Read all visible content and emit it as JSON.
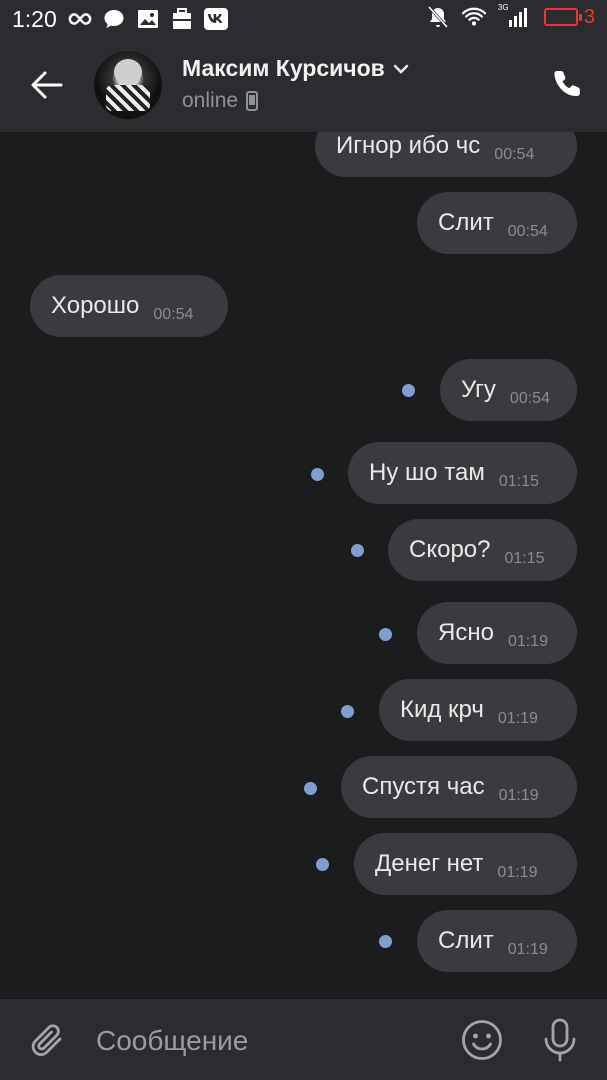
{
  "status_bar": {
    "time": "1:20",
    "battery_level": "3",
    "network_label": "3G",
    "left_icons": [
      "infinity-icon",
      "chat-bubble-icon",
      "image-icon",
      "briefcase-icon",
      "vk-icon"
    ],
    "right_icons": [
      "mute-icon",
      "wifi-icon",
      "signal-icon",
      "battery-icon"
    ]
  },
  "header": {
    "contact_name": "Максим Курсичов",
    "status": "online"
  },
  "messages": [
    {
      "text": "Игнор ибо чс",
      "time": "00:54",
      "side": "out",
      "unread": false
    },
    {
      "text": "Слит",
      "time": "00:54",
      "side": "out",
      "unread": false
    },
    {
      "text": "Хорошо",
      "time": "00:54",
      "side": "in",
      "unread": false
    },
    {
      "text": "Угу",
      "time": "00:54",
      "side": "out",
      "unread": true
    },
    {
      "text": "Ну шо там",
      "time": "01:15",
      "side": "out",
      "unread": true
    },
    {
      "text": "Скоро?",
      "time": "01:15",
      "side": "out",
      "unread": true
    },
    {
      "text": "Ясно",
      "time": "01:19",
      "side": "out",
      "unread": true
    },
    {
      "text": "Кид крч",
      "time": "01:19",
      "side": "out",
      "unread": true
    },
    {
      "text": "Спустя час",
      "time": "01:19",
      "side": "out",
      "unread": true
    },
    {
      "text": "Денег нет",
      "time": "01:19",
      "side": "out",
      "unread": true
    },
    {
      "text": "Слит",
      "time": "01:19",
      "side": "out",
      "unread": true
    }
  ],
  "composer": {
    "placeholder": "Сообщение"
  },
  "colors": {
    "background": "#1b1c1e",
    "bar": "#2b2c2f",
    "bubble": "#3a3b3e",
    "unread_dot": "#7f9fd0",
    "battery_low": "#e53935"
  }
}
